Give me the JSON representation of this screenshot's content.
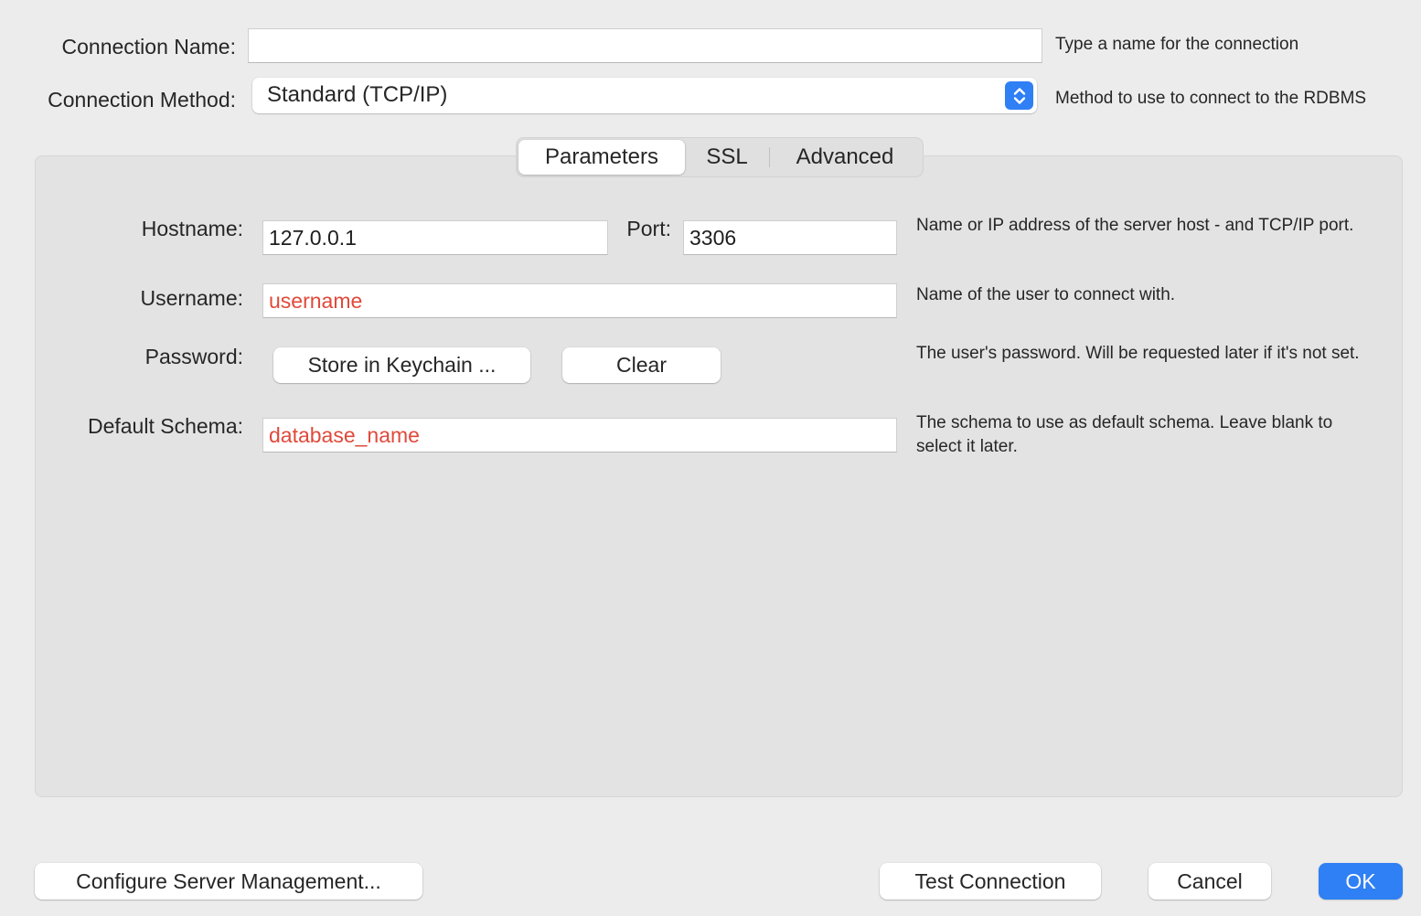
{
  "connection_name": {
    "label": "Connection Name:",
    "value": "",
    "help": "Type a name for the connection"
  },
  "connection_method": {
    "label": "Connection Method:",
    "value": "Standard (TCP/IP)",
    "help": "Method to use to connect to the RDBMS"
  },
  "tabs": [
    {
      "label": "Parameters",
      "active": true
    },
    {
      "label": "SSL",
      "active": false
    },
    {
      "label": "Advanced",
      "active": false
    }
  ],
  "parameters": {
    "hostname": {
      "label": "Hostname:",
      "value": "127.0.0.1"
    },
    "port": {
      "label": "Port:",
      "value": "3306"
    },
    "hostname_help": "Name or IP address of the server host - and TCP/IP port.",
    "username": {
      "label": "Username:",
      "value": "username",
      "help": "Name of the user to connect with."
    },
    "password": {
      "label": "Password:",
      "store_button": "Store in Keychain ...",
      "clear_button": "Clear",
      "help": "The user's password. Will be requested later if it's not set."
    },
    "default_schema": {
      "label": "Default Schema:",
      "value": "database_name",
      "help": "The schema to use as default schema. Leave blank to select it later."
    }
  },
  "footer": {
    "configure_button": "Configure Server Management...",
    "test_button": "Test Connection",
    "cancel_button": "Cancel",
    "ok_button": "OK"
  },
  "colors": {
    "accent": "#2f7ff5",
    "placeholder_text": "#e0493a",
    "window_bg": "#ececec",
    "panel_bg": "#e3e3e3"
  },
  "icons": {
    "method_stepper": "up-down-chevron-icon"
  }
}
